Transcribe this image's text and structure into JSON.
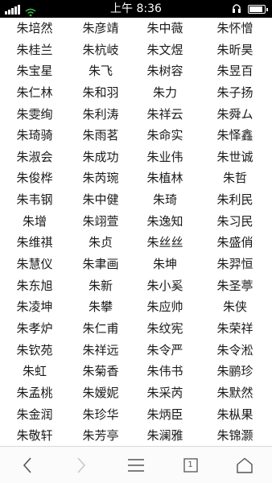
{
  "status_bar": {
    "time": "上午 8:36",
    "battery_level": 0.9,
    "icons": [
      "signal-icon",
      "wifi-icon",
      "headset-icon",
      "battery-icon"
    ]
  },
  "names": [
    [
      "朱培然",
      "朱彦靖",
      "朱中薇",
      "朱怀憎"
    ],
    [
      "朱桂兰",
      "朱杭岐",
      "朱文煜",
      "朱昕昊"
    ],
    [
      "朱宝星",
      "朱飞",
      "朱树容",
      "朱昱百"
    ],
    [
      "朱仁林",
      "朱和羽",
      "朱力",
      "朱子扬"
    ],
    [
      "朱雯绚",
      "朱利涛",
      "朱祥云",
      "朱舜ム"
    ],
    [
      "朱琦骑",
      "朱雨茗",
      "朱命实",
      "朱怿鑫"
    ],
    [
      "朱淑会",
      "朱成功",
      "朱业伟",
      "朱世诚"
    ],
    [
      "朱俊桦",
      "朱芮琬",
      "朱植林",
      "朱哲"
    ],
    [
      "朱韦钢",
      "朱中健",
      "朱琦",
      "朱利民"
    ],
    [
      "朱增",
      "朱翊萱",
      "朱逸知",
      "朱习民"
    ],
    [
      "朱维祺",
      "朱贞",
      "朱丝丝",
      "朱盛俏"
    ],
    [
      "朱慧仪",
      "朱聿画",
      "朱坤",
      "朱羿恒"
    ],
    [
      "朱东旭",
      "朱新",
      "朱小奚",
      "朱圣葶"
    ],
    [
      "朱凌坤",
      "朱攀",
      "朱应帅",
      "朱侠"
    ],
    [
      "朱孝炉",
      "朱仁甫",
      "朱纹宪",
      "朱荣祥"
    ],
    [
      "朱钦苑",
      "朱祥远",
      "朱令严",
      "朱令淞"
    ],
    [
      "朱虹",
      "朱菊香",
      "朱伟书",
      "朱鹂珍"
    ],
    [
      "朱孟桃",
      "朱嫒妮",
      "朱采芮",
      "朱默然"
    ],
    [
      "朱金润",
      "朱珍华",
      "朱炳臣",
      "朱枞果"
    ],
    [
      "朱敬轩",
      "朱芳亭",
      "朱澜雅",
      "朱锦灏"
    ]
  ],
  "bottom_nav": {
    "tab_count": "1",
    "buttons": [
      "back-icon",
      "forward-icon",
      "menu-icon",
      "tabs-icon",
      "home-icon"
    ]
  }
}
